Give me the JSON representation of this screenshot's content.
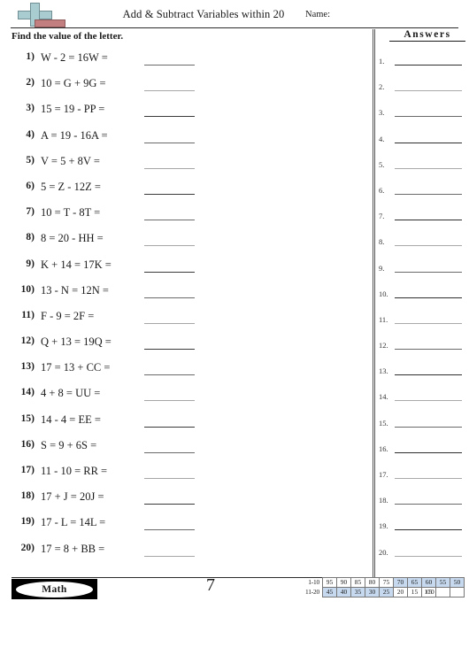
{
  "header": {
    "title": "Add & Subtract Variables within 20",
    "name_label": "Name:",
    "logo_name": "plus-minus-logo"
  },
  "instruction": "Find the value of the letter.",
  "answers_heading": "Answers",
  "problems": [
    {
      "number": "1)",
      "expression": "W - 2 = 16W ="
    },
    {
      "number": "2)",
      "expression": "10 = G + 9G ="
    },
    {
      "number": "3)",
      "expression": "15 = 19 - PP ="
    },
    {
      "number": "4)",
      "expression": "A = 19 - 16A ="
    },
    {
      "number": "5)",
      "expression": "V = 5 + 8V ="
    },
    {
      "number": "6)",
      "expression": "5 = Z - 12Z ="
    },
    {
      "number": "7)",
      "expression": "10 = T - 8T ="
    },
    {
      "number": "8)",
      "expression": "8 = 20 - HH ="
    },
    {
      "number": "9)",
      "expression": "K + 14 = 17K ="
    },
    {
      "number": "10)",
      "expression": "13 - N = 12N ="
    },
    {
      "number": "11)",
      "expression": "F - 9 = 2F ="
    },
    {
      "number": "12)",
      "expression": "Q + 13 = 19Q ="
    },
    {
      "number": "13)",
      "expression": "17 = 13 + CC ="
    },
    {
      "number": "14)",
      "expression": "4 + 8 = UU ="
    },
    {
      "number": "15)",
      "expression": "14 - 4 = EE ="
    },
    {
      "number": "16)",
      "expression": "S = 9 + 6S ="
    },
    {
      "number": "17)",
      "expression": "11 - 10 = RR ="
    },
    {
      "number": "18)",
      "expression": "17 + J = 20J ="
    },
    {
      "number": "19)",
      "expression": "17 - L = 14L ="
    },
    {
      "number": "20)",
      "expression": "17 = 8 + BB ="
    }
  ],
  "answer_slots": [
    "1.",
    "2.",
    "3.",
    "4.",
    "5.",
    "6.",
    "7.",
    "8.",
    "9.",
    "10.",
    "11.",
    "12.",
    "13.",
    "14.",
    "15.",
    "16.",
    "17.",
    "18.",
    "19.",
    "20."
  ],
  "footer": {
    "subject_badge": "Math",
    "page_number": "7"
  },
  "grade_table": {
    "row1_label": "1-10",
    "row2_label": "11-20",
    "row1": [
      {
        "value": "95",
        "shaded": false
      },
      {
        "value": "90",
        "shaded": false
      },
      {
        "value": "85",
        "shaded": false
      },
      {
        "value": "80",
        "shaded": false
      },
      {
        "value": "75",
        "shaded": false
      },
      {
        "value": "70",
        "shaded": true
      },
      {
        "value": "65",
        "shaded": true
      },
      {
        "value": "60",
        "shaded": true
      },
      {
        "value": "55",
        "shaded": true
      },
      {
        "value": "50",
        "shaded": true
      }
    ],
    "row2": [
      {
        "value": "45",
        "shaded": true
      },
      {
        "value": "40",
        "shaded": true
      },
      {
        "value": "35",
        "shaded": true
      },
      {
        "value": "30",
        "shaded": true
      },
      {
        "value": "25",
        "shaded": true
      },
      {
        "value": "20",
        "shaded": false
      },
      {
        "value": "15",
        "shaded": false
      },
      {
        "value": "1050",
        "shaded": false
      },
      {
        "value": "",
        "shaded": false
      },
      {
        "value": "",
        "shaded": false
      }
    ]
  },
  "colors": {
    "logo_plus": "#a8ccd0",
    "logo_minus": "#c37f80",
    "grade_shade": "#c6d9ee",
    "rule": "#2b2b2b"
  }
}
